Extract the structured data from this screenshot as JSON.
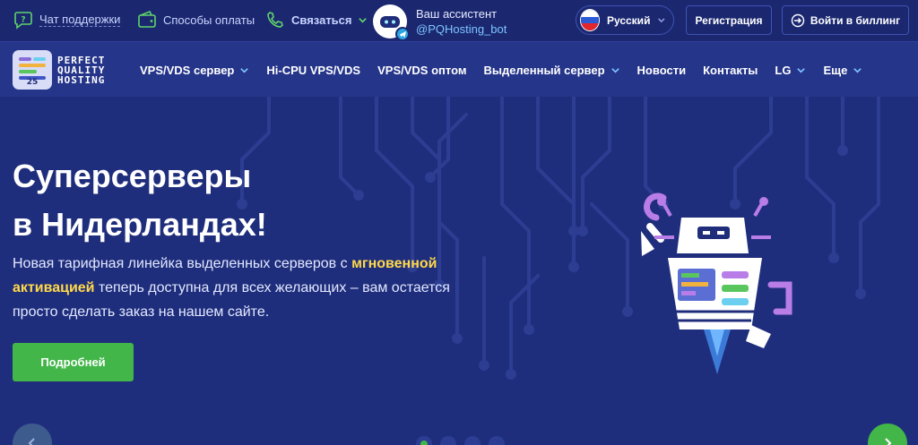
{
  "topbar": {
    "chat_label": "Чат поддержки",
    "payment_label": "Способы оплаты",
    "contact_label": "Связаться",
    "assistant_title": "Ваш ассистент",
    "assistant_bot": "@PQHosting_bot",
    "language": "Русский",
    "register_label": "Регистрация",
    "login_label": "Войти в биллинг"
  },
  "logo": {
    "line1": "PERFECT",
    "line2": "QUALITY",
    "line3": "HOSTING"
  },
  "nav": {
    "items": [
      {
        "label": "VPS/VDS сервер",
        "dropdown": true
      },
      {
        "label": "Hi-CPU VPS/VDS",
        "dropdown": false
      },
      {
        "label": "VPS/VDS оптом",
        "dropdown": false
      },
      {
        "label": "Выделенный сервер",
        "dropdown": true
      },
      {
        "label": "Новости",
        "dropdown": false
      },
      {
        "label": "Контакты",
        "dropdown": false
      },
      {
        "label": "LG",
        "dropdown": true
      },
      {
        "label": "Еще",
        "dropdown": true
      }
    ]
  },
  "hero": {
    "title_line1": "Суперсерверы",
    "title_line2": "в Нидерландах!",
    "desc_part1": "Новая тарифная линейка выделенных серверов с ",
    "desc_highlight": "мгновенной активацией",
    "desc_part2": " теперь доступна для всех желающих – вам остается просто сделать заказ на нашем сайте.",
    "button_label": "Подробней",
    "slides_total": 4,
    "slide_active": 1
  },
  "colors": {
    "accent_green": "#43b649",
    "highlight_yellow": "#ffd84a",
    "bg_navy": "#1f2d7a",
    "link_blue": "#7ec4ff"
  }
}
